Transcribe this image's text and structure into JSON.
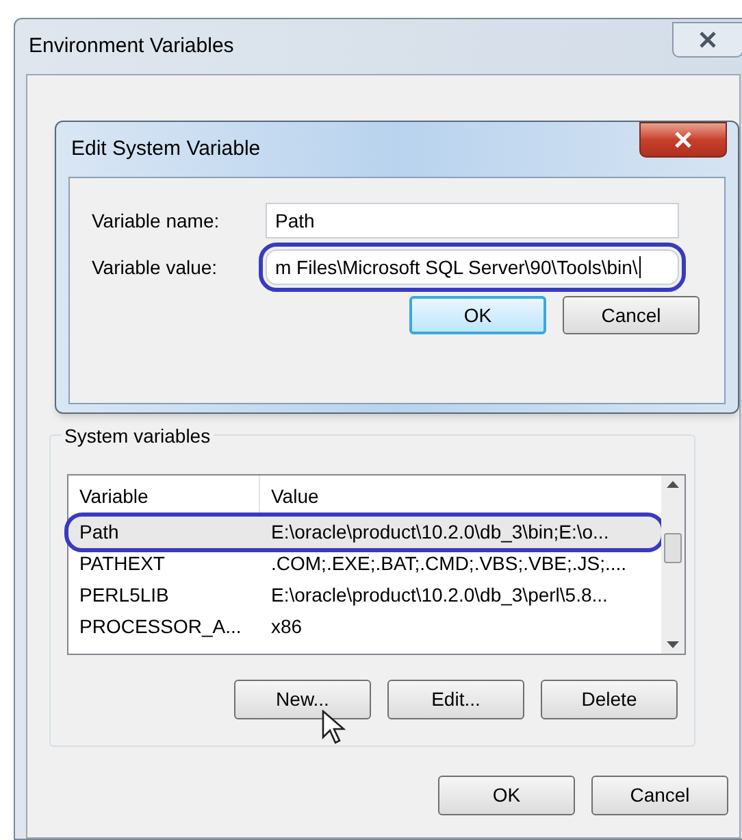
{
  "window": {
    "title": "Environment Variables"
  },
  "edit_dialog": {
    "title": "Edit System Variable",
    "fields": [
      {
        "label": "Variable name:",
        "value": "Path",
        "circled": false
      },
      {
        "label": "Variable value:",
        "value": "m Files\\Microsoft SQL Server\\90\\Tools\\bin\\",
        "circled": true
      }
    ],
    "buttons": [
      {
        "label": "OK",
        "default": true
      },
      {
        "label": "Cancel",
        "default": false
      }
    ]
  },
  "system_variables": {
    "title": "System variables",
    "columns": [
      "Variable",
      "Value"
    ],
    "rows": [
      {
        "cells": [
          "Path",
          "E:\\oracle\\product\\10.2.0\\db_3\\bin;E:\\o..."
        ],
        "selected": true,
        "circled": true
      },
      {
        "cells": [
          "PATHEXT",
          ".COM;.EXE;.BAT;.CMD;.VBS;.VBE;.JS;...."
        ],
        "selected": false,
        "circled": false
      },
      {
        "cells": [
          "PERL5LIB",
          "E:\\oracle\\product\\10.2.0\\db_3\\perl\\5.8..."
        ],
        "selected": false,
        "circled": false
      },
      {
        "cells": [
          "PROCESSOR_A...",
          "x86"
        ],
        "selected": false,
        "circled": false
      }
    ],
    "buttons": [
      "New...",
      "Edit...",
      "Delete"
    ]
  },
  "buttons": [
    "OK",
    "Cancel"
  ]
}
